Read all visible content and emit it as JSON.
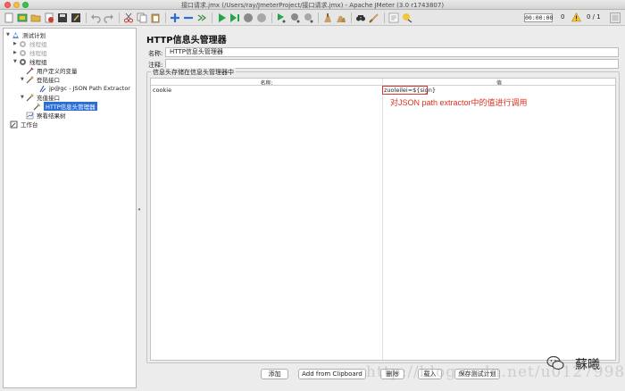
{
  "window": {
    "title": "接口请求.jmx (/Users/ray/JmeterProject/接口请求.jmx) - Apache JMeter (3.0 r1743807)"
  },
  "toolbar": {
    "timer": "00:00:00",
    "error_count": "0",
    "threads": "0 / 1",
    "icons": [
      "new-icon",
      "templates-icon",
      "open-icon",
      "close-icon",
      "save-icon",
      "save-as-icon",
      "cut-icon",
      "copy-icon",
      "paste-icon",
      "expand-icon",
      "collapse-icon",
      "toggle-icon",
      "start-icon",
      "start-no-pause-icon",
      "stop-icon",
      "shutdown-icon",
      "remote-start-icon",
      "remote-stop-icon",
      "remote-shutdown-icon",
      "clear-icon",
      "clear-all-icon",
      "search-icon",
      "reset-search-icon",
      "function-helper-icon",
      "help-icon"
    ]
  },
  "tree": {
    "nodes": [
      {
        "label": "测试计划",
        "icon": "test-plan-icon",
        "expanded": true,
        "disabled": false,
        "selected": false
      },
      {
        "label": "线程组",
        "icon": "thread-group-icon",
        "expanded": false,
        "disabled": true,
        "selected": false
      },
      {
        "label": "线程组",
        "icon": "thread-group-icon",
        "expanded": false,
        "disabled": true,
        "selected": false
      },
      {
        "label": "线程组",
        "icon": "thread-group-icon",
        "expanded": true,
        "disabled": false,
        "selected": false
      },
      {
        "label": "用户定义的变量",
        "icon": "variables-icon",
        "expanded": null,
        "disabled": false,
        "selected": false
      },
      {
        "label": "登陆接口",
        "icon": "sampler-icon",
        "expanded": true,
        "disabled": false,
        "selected": false
      },
      {
        "label": "jp@gc - JSON Path Extractor",
        "icon": "extractor-icon",
        "expanded": null,
        "disabled": false,
        "selected": false
      },
      {
        "label": "充值接口",
        "icon": "sampler-icon",
        "expanded": true,
        "disabled": false,
        "selected": false
      },
      {
        "label": "HTTP信息头管理器",
        "icon": "header-manager-icon",
        "expanded": null,
        "disabled": false,
        "selected": true
      },
      {
        "label": "察看结果树",
        "icon": "listener-icon",
        "expanded": null,
        "disabled": false,
        "selected": false
      },
      {
        "label": "工作台",
        "icon": "workbench-icon",
        "expanded": null,
        "disabled": false,
        "selected": false
      }
    ]
  },
  "panel": {
    "heading": "HTTP信息头管理器",
    "name_label": "名称:",
    "name_value": "HTTP信息头管理器",
    "comment_label": "注释:",
    "comment_value": "",
    "group_title": "信息头存储在信息头管理器中",
    "table": {
      "columns": [
        "名称:",
        "值"
      ],
      "rows": [
        {
          "name": "cookie",
          "value": "zuoleilei=${sign}"
        }
      ]
    },
    "annotation": "对JSON path extractor中的值进行调用",
    "buttons": {
      "add": "添加",
      "add_from_clipboard": "Add from Clipboard",
      "delete": "删除",
      "load": "载入",
      "save_test_plan": "保存测试计划"
    }
  },
  "watermark": {
    "url": "http://blog.csdn.net/u012799877",
    "brand": "蘇曦"
  }
}
